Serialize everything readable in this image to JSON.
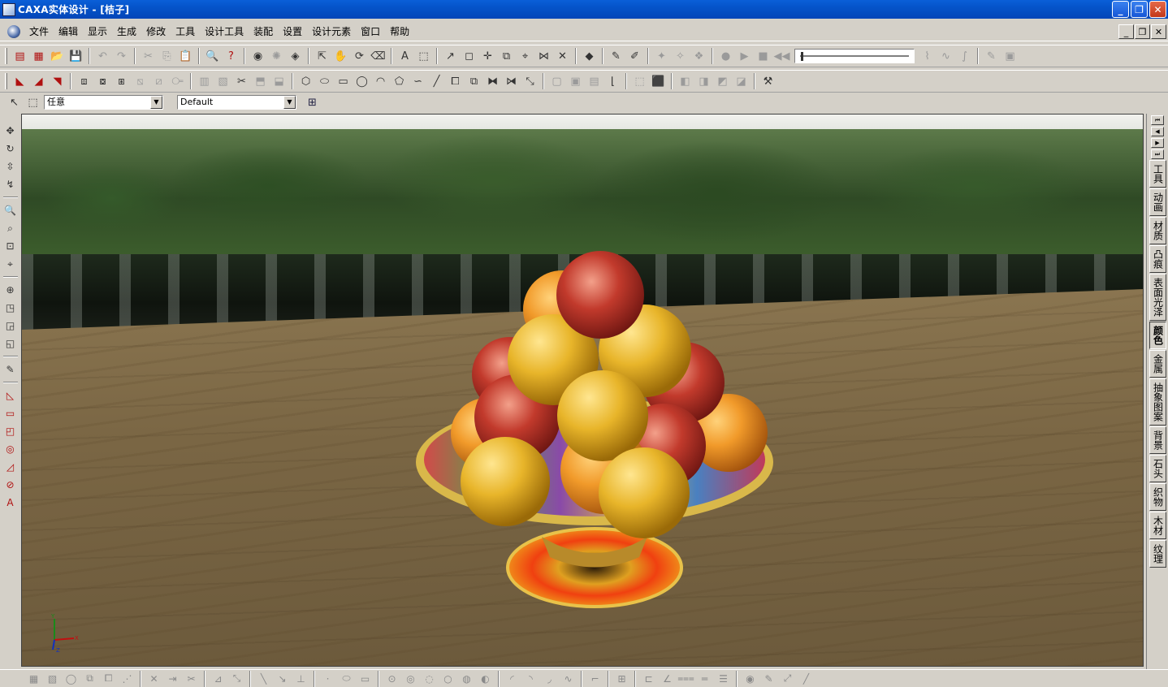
{
  "window": {
    "title": "CAXA实体设计 - [桔子]"
  },
  "menu": {
    "items": [
      "文件",
      "编辑",
      "显示",
      "生成",
      "修改",
      "工具",
      "设计工具",
      "装配",
      "设置",
      "设计元素",
      "窗口",
      "帮助"
    ]
  },
  "selector": {
    "filter_value": "任意",
    "style_value": "Default"
  },
  "viewport": {
    "axes": {
      "y": "Y",
      "x": "X",
      "z": "Z"
    }
  },
  "right_tabs": [
    "工具",
    "动画",
    "材质",
    "凸痕",
    "表面光泽",
    "颜色",
    "金属",
    "抽象图案",
    "背景",
    "石头",
    "织物",
    "木材",
    "纹理"
  ],
  "right_tabs_active": "颜色",
  "colors": {
    "titlebar": "#0553c9",
    "chrome": "#d4d0c8"
  }
}
